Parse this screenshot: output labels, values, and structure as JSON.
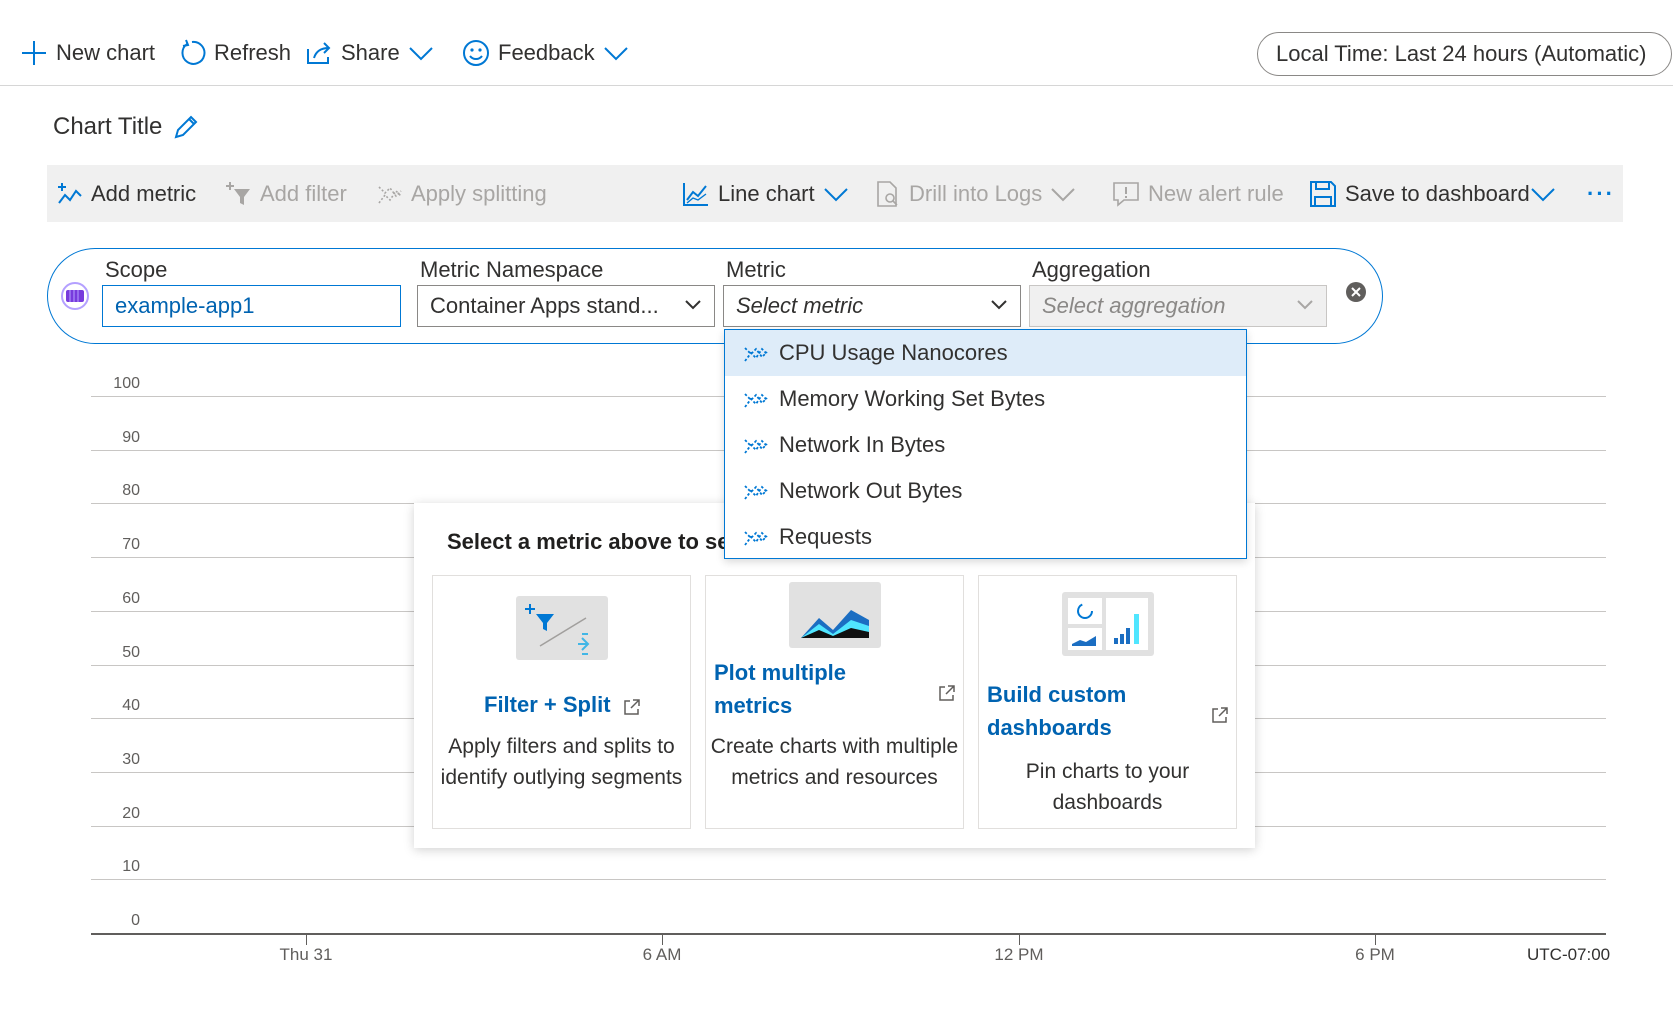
{
  "topbar": {
    "new_chart": "New chart",
    "refresh": "Refresh",
    "share": "Share",
    "feedback": "Feedback",
    "time_range": "Local Time: Last 24 hours (Automatic)"
  },
  "chart": {
    "title": "Chart Title"
  },
  "toolbar": {
    "add_metric": "Add metric",
    "add_filter": "Add filter",
    "apply_splitting": "Apply splitting",
    "line_chart": "Line chart",
    "drill_into_logs": "Drill into Logs",
    "new_alert_rule": "New alert rule",
    "save_to_dashboard": "Save to dashboard",
    "more": "···"
  },
  "metric_row": {
    "scope_label": "Scope",
    "scope_value": "example-app1",
    "namespace_label": "Metric Namespace",
    "namespace_value": "Container Apps stand...",
    "metric_label": "Metric",
    "metric_placeholder": "Select metric",
    "aggregation_label": "Aggregation",
    "aggregation_placeholder": "Select aggregation"
  },
  "metric_dropdown": {
    "options": [
      {
        "label": "CPU Usage Nanocores",
        "selected": true
      },
      {
        "label": "Memory Working Set Bytes",
        "selected": false
      },
      {
        "label": "Network In Bytes",
        "selected": false
      },
      {
        "label": "Network Out Bytes",
        "selected": false
      },
      {
        "label": "Requests",
        "selected": false
      }
    ]
  },
  "info_panel": {
    "title": "Select a metric above to se",
    "cards": [
      {
        "title": "Filter + Split",
        "description": "Apply filters and splits to identify outlying segments"
      },
      {
        "title": "Plot multiple metrics",
        "description": "Create charts with multiple metrics and resources"
      },
      {
        "title": "Build custom dashboards",
        "description": "Pin charts to your dashboards"
      }
    ]
  },
  "chart_data": {
    "type": "line",
    "y_ticks": [
      "100",
      "90",
      "80",
      "70",
      "60",
      "50",
      "40",
      "30",
      "20",
      "10",
      "0"
    ],
    "ylim": [
      0,
      100
    ],
    "x_ticks": [
      "Thu 31",
      "6 AM",
      "12 PM",
      "6 PM"
    ],
    "timezone": "UTC-07:00",
    "series": []
  },
  "colors": {
    "accent": "#0078d4",
    "link": "#0063b1",
    "dropdown_selected": "#deecf9",
    "toolbar_bg": "#f0f0f0"
  }
}
